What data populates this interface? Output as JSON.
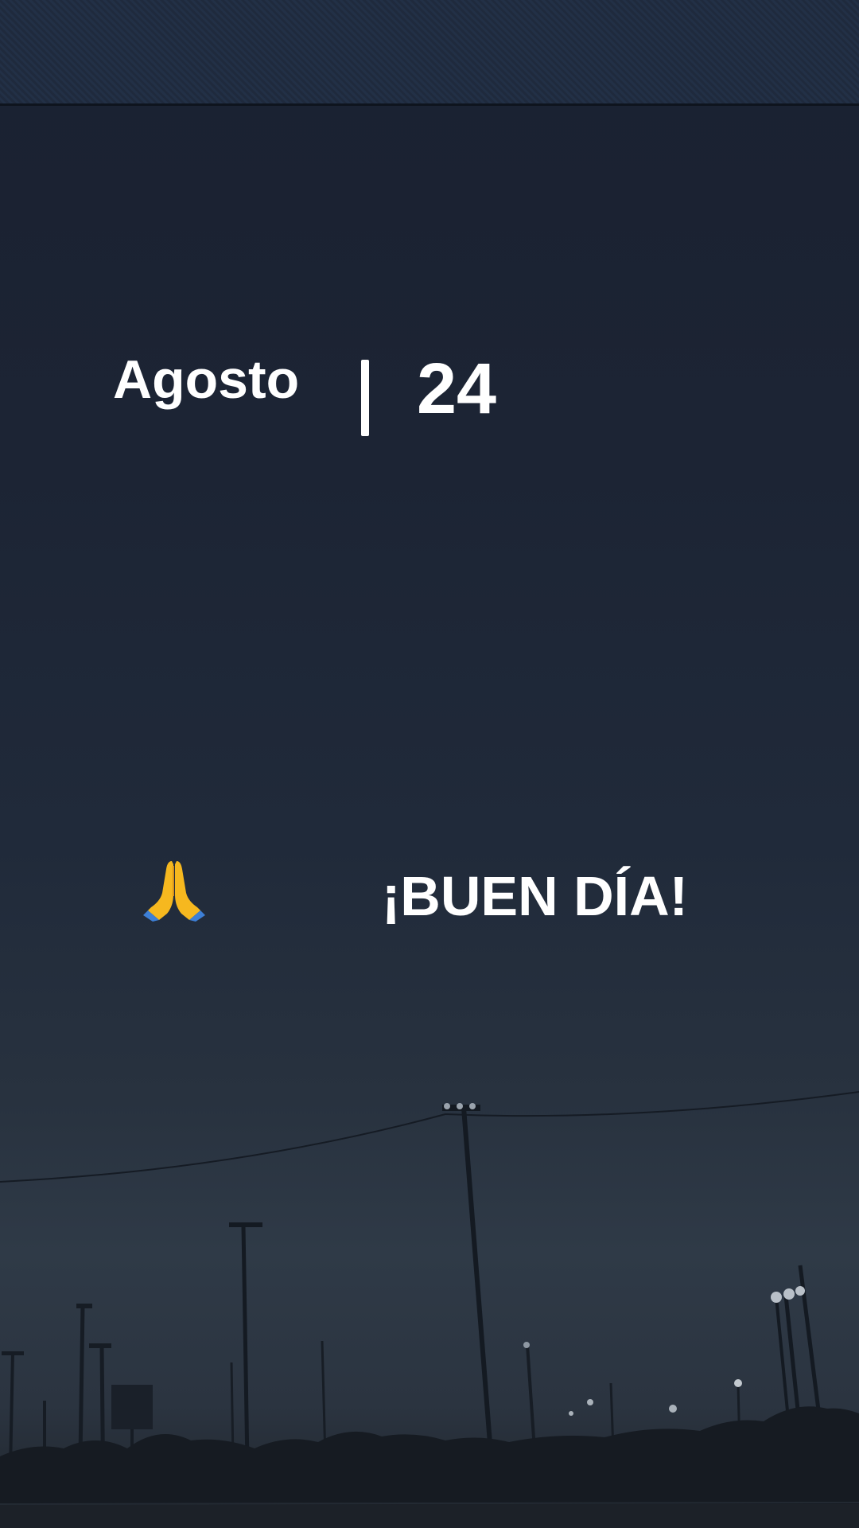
{
  "date": {
    "month": "Agosto",
    "separator": "|",
    "day": "24"
  },
  "greeting": {
    "icon": "praying-hands-icon",
    "text": "¡BUEN DÍA!"
  },
  "colors": {
    "sky_top": "#1a2131",
    "sky_horizon": "#2f3a47",
    "text": "#ffffff"
  }
}
